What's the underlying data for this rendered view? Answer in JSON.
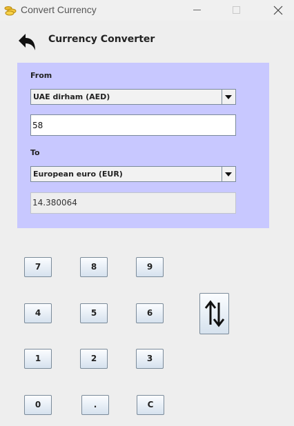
{
  "window": {
    "title": "Convert Currency",
    "controls": [
      "minimize",
      "maximize",
      "close"
    ]
  },
  "header": {
    "title": "Currency Converter",
    "back_icon": "back-arrow-icon"
  },
  "converter": {
    "from_label": "From",
    "from_currency": "UAE dirham (AED)",
    "amount": "58",
    "to_label": "To",
    "to_currency": "European euro (EUR)",
    "result": "14.380064",
    "panel_color": "#c8c8ff"
  },
  "keypad": {
    "keys": [
      "7",
      "8",
      "9",
      "4",
      "5",
      "6",
      "1",
      "2",
      "3",
      "0",
      ".",
      "C"
    ],
    "swap_icon": "swap-vertical-icon"
  }
}
